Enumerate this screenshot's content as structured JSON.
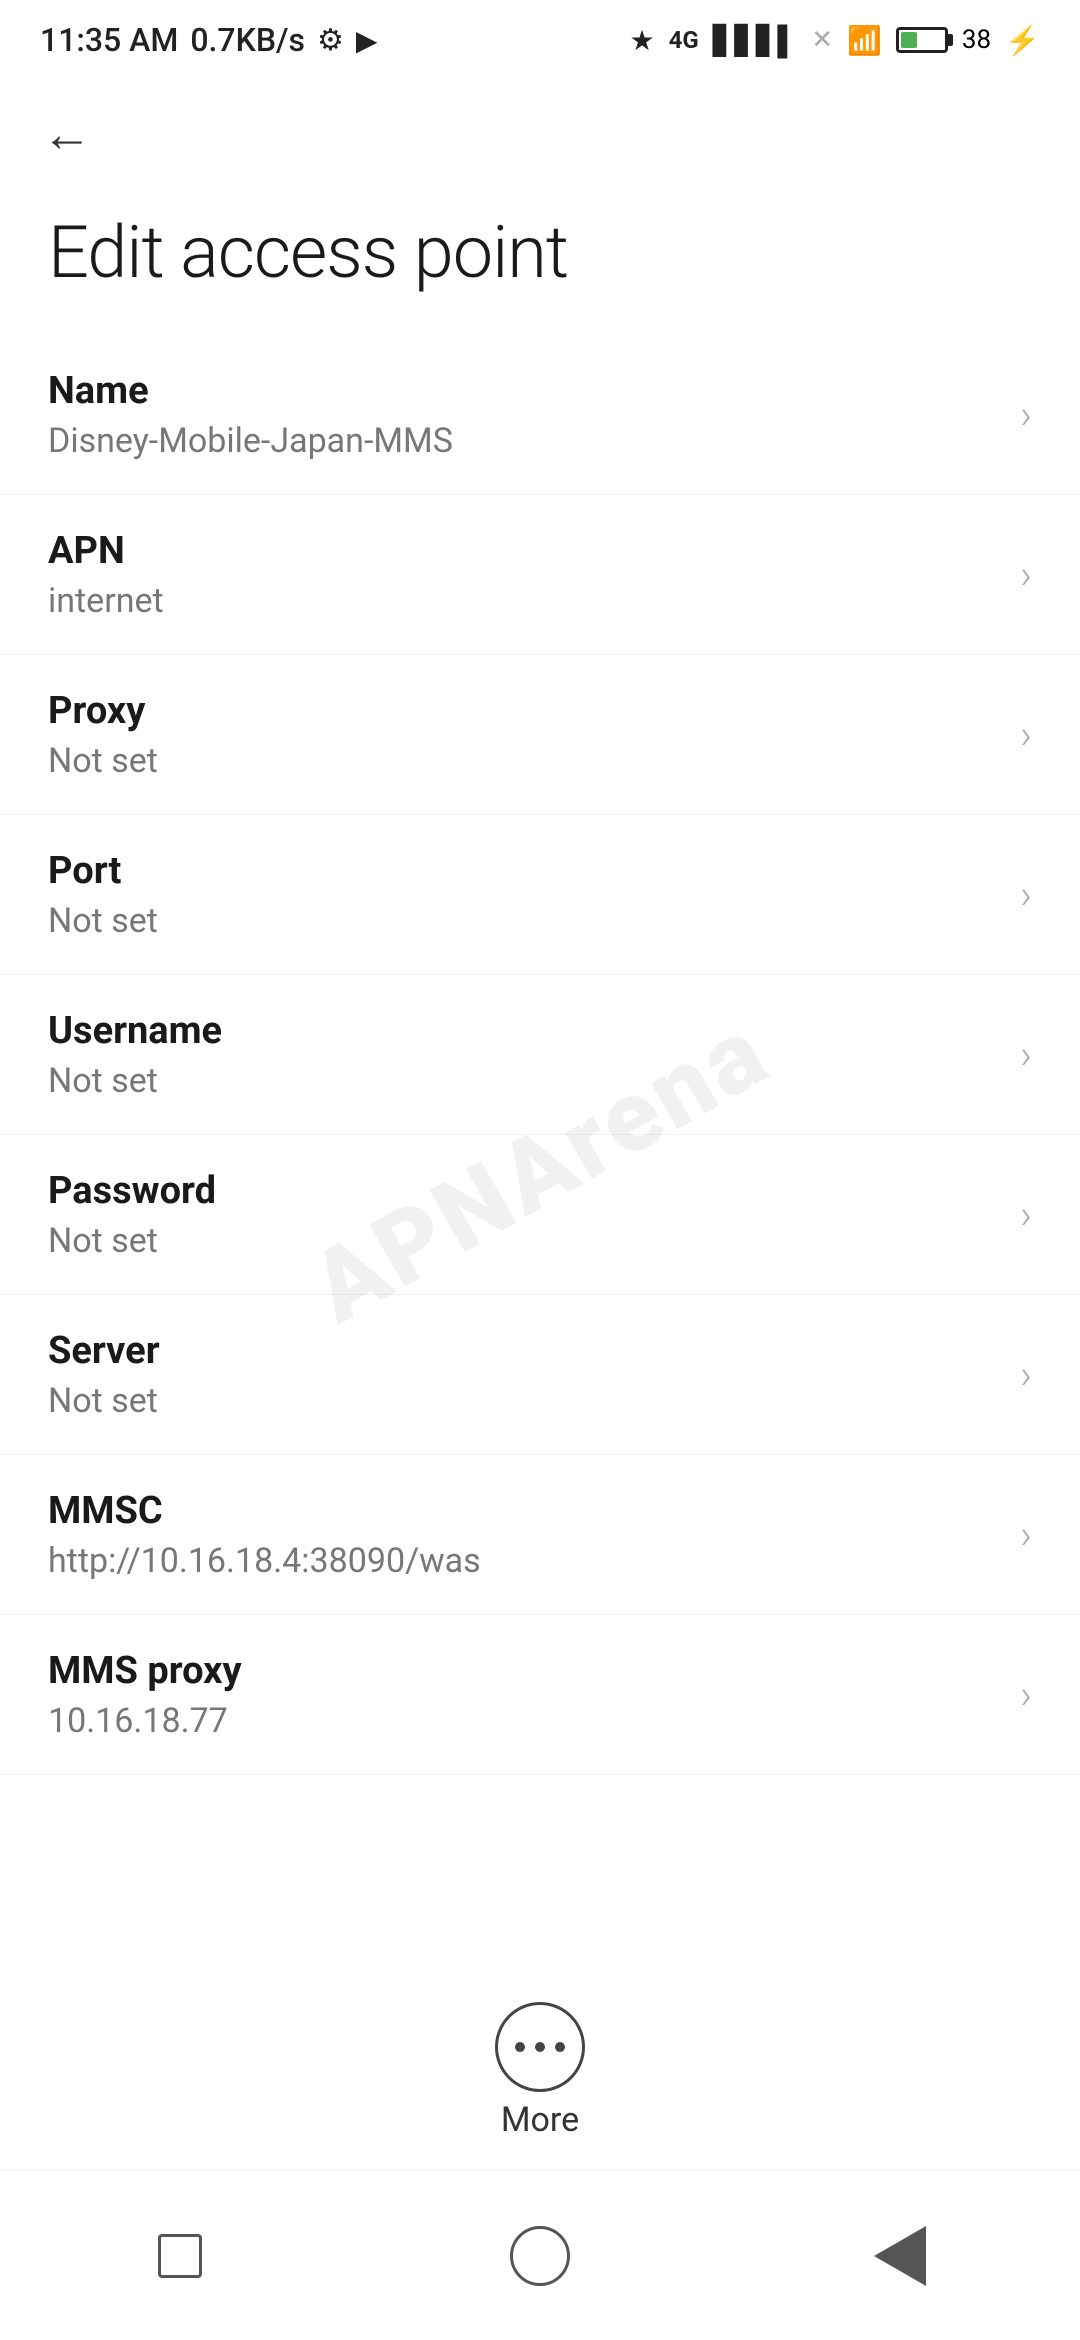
{
  "status_bar": {
    "time": "11:35 AM",
    "network_speed": "0.7KB/s"
  },
  "toolbar": {
    "back_label": "←"
  },
  "page": {
    "title": "Edit access point"
  },
  "settings_items": [
    {
      "label": "Name",
      "value": "Disney-Mobile-Japan-MMS"
    },
    {
      "label": "APN",
      "value": "internet"
    },
    {
      "label": "Proxy",
      "value": "Not set"
    },
    {
      "label": "Port",
      "value": "Not set"
    },
    {
      "label": "Username",
      "value": "Not set"
    },
    {
      "label": "Password",
      "value": "Not set"
    },
    {
      "label": "Server",
      "value": "Not set"
    },
    {
      "label": "MMSC",
      "value": "http://10.16.18.4:38090/was"
    },
    {
      "label": "MMS proxy",
      "value": "10.16.18.77"
    }
  ],
  "more_button": {
    "label": "More"
  },
  "watermark": {
    "text": "APNArena"
  }
}
